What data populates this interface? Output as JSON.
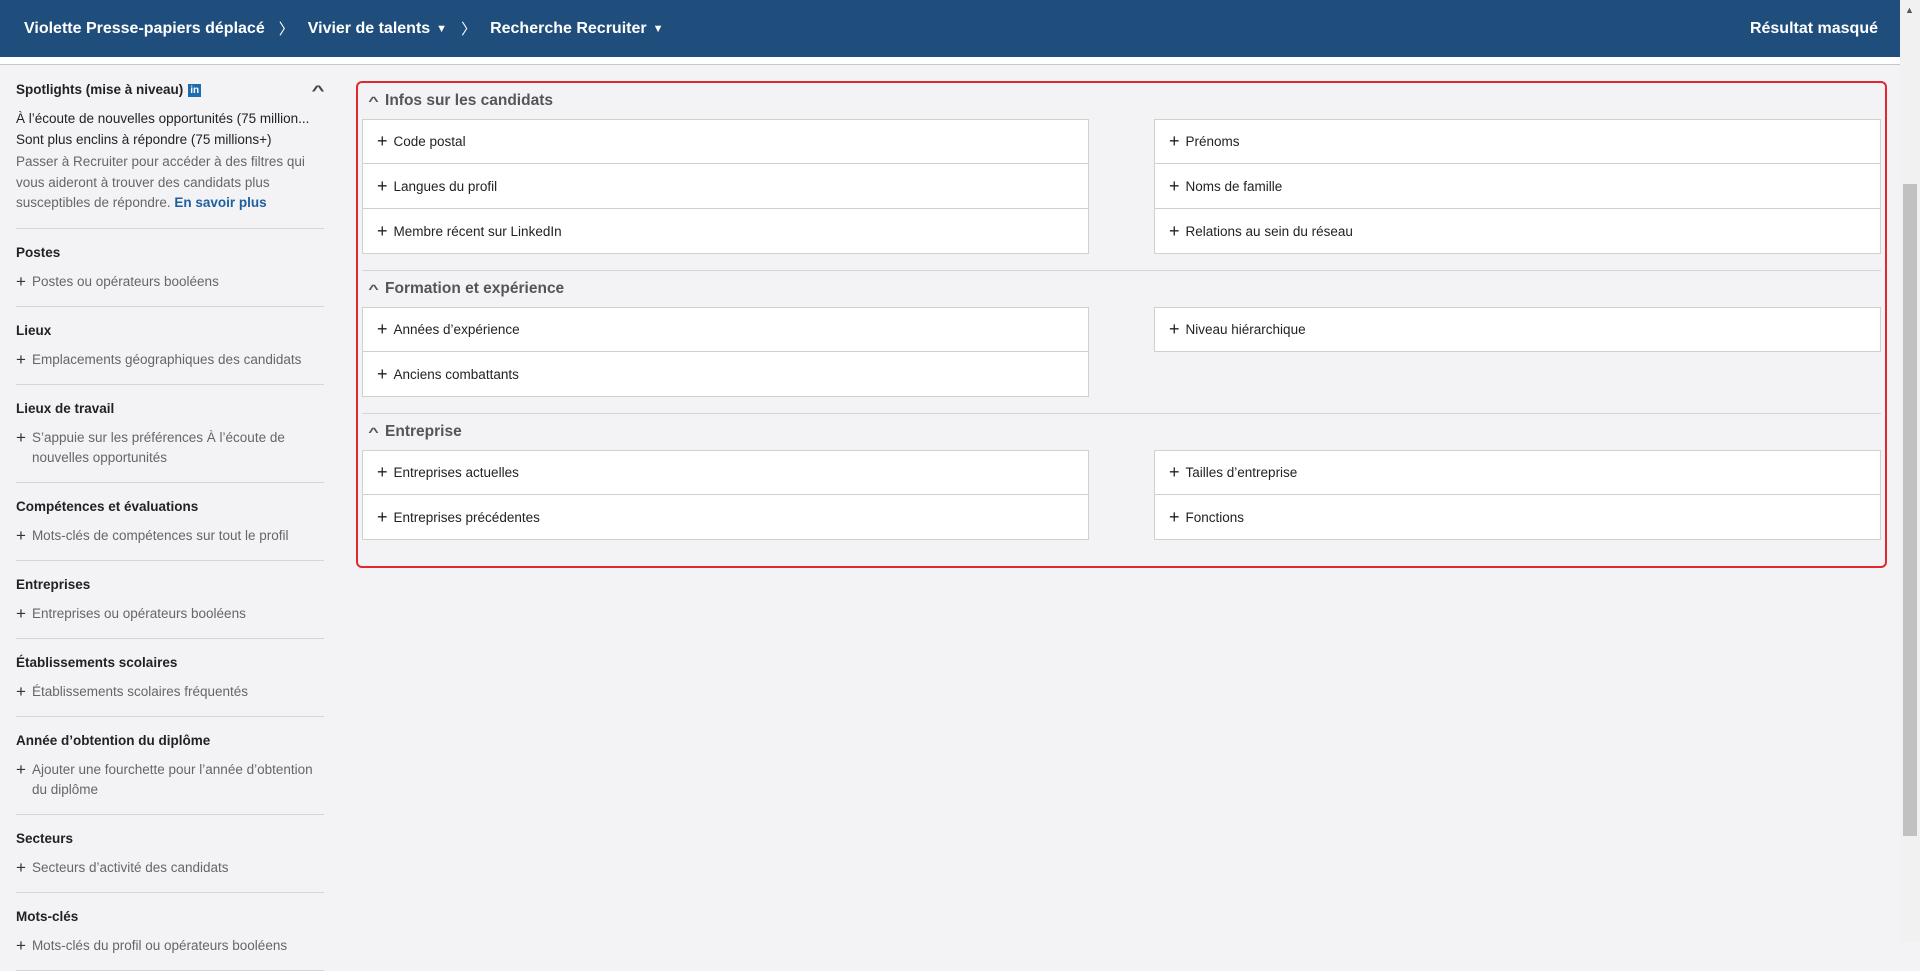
{
  "header": {
    "breadcrumbs": [
      "Violette Presse-papiers déplacé",
      "Vivier de talents",
      "Recherche Recruiter"
    ],
    "right": "Résultat masqué"
  },
  "sidebar": {
    "spotlights": {
      "title": "Spotlights (mise à niveau)",
      "badge": "in",
      "items": [
        "À l’écoute de nouvelles opportunités (75 million...",
        "Sont plus enclins à répondre (75 millions+)"
      ],
      "desc": "Passer à Recruiter pour accéder à des filtres qui vous aideront à trouver des candidats plus susceptibles de répondre.",
      "link": "En savoir plus"
    },
    "sections": [
      {
        "title": "Postes",
        "add": "Postes ou opérateurs booléens"
      },
      {
        "title": "Lieux",
        "add": "Emplacements géographiques des candidats"
      },
      {
        "title": "Lieux de travail",
        "add": "S’appuie sur les préférences À l’écoute de nouvelles opportunités"
      },
      {
        "title": "Compétences et évaluations",
        "add": "Mots-clés de compétences sur tout le profil"
      },
      {
        "title": "Entreprises",
        "add": "Entreprises ou opérateurs booléens"
      },
      {
        "title": "Établissements scolaires",
        "add": "Établissements scolaires fréquentés"
      },
      {
        "title": "Année d’obtention du diplôme",
        "add": "Ajouter une fourchette pour l’année d’obtention du diplôme"
      },
      {
        "title": "Secteurs",
        "add": "Secteurs d’activité des candidats"
      },
      {
        "title": "Mots-clés",
        "add": "Mots-clés du profil ou opérateurs booléens"
      }
    ]
  },
  "main": {
    "sections": [
      {
        "title": "Infos sur les candidats",
        "left": [
          "Code postal",
          "Langues du profil",
          "Membre récent sur LinkedIn"
        ],
        "right": [
          "Prénoms",
          "Noms de famille",
          "Relations au sein du réseau"
        ]
      },
      {
        "title": "Formation et expérience",
        "left": [
          "Années d’expérience",
          "Anciens combattants"
        ],
        "right": [
          "Niveau hiérarchique"
        ]
      },
      {
        "title": "Entreprise",
        "left": [
          "Entreprises actuelles",
          "Entreprises précédentes"
        ],
        "right": [
          "Tailles d’entreprise",
          "Fonctions"
        ]
      }
    ]
  }
}
